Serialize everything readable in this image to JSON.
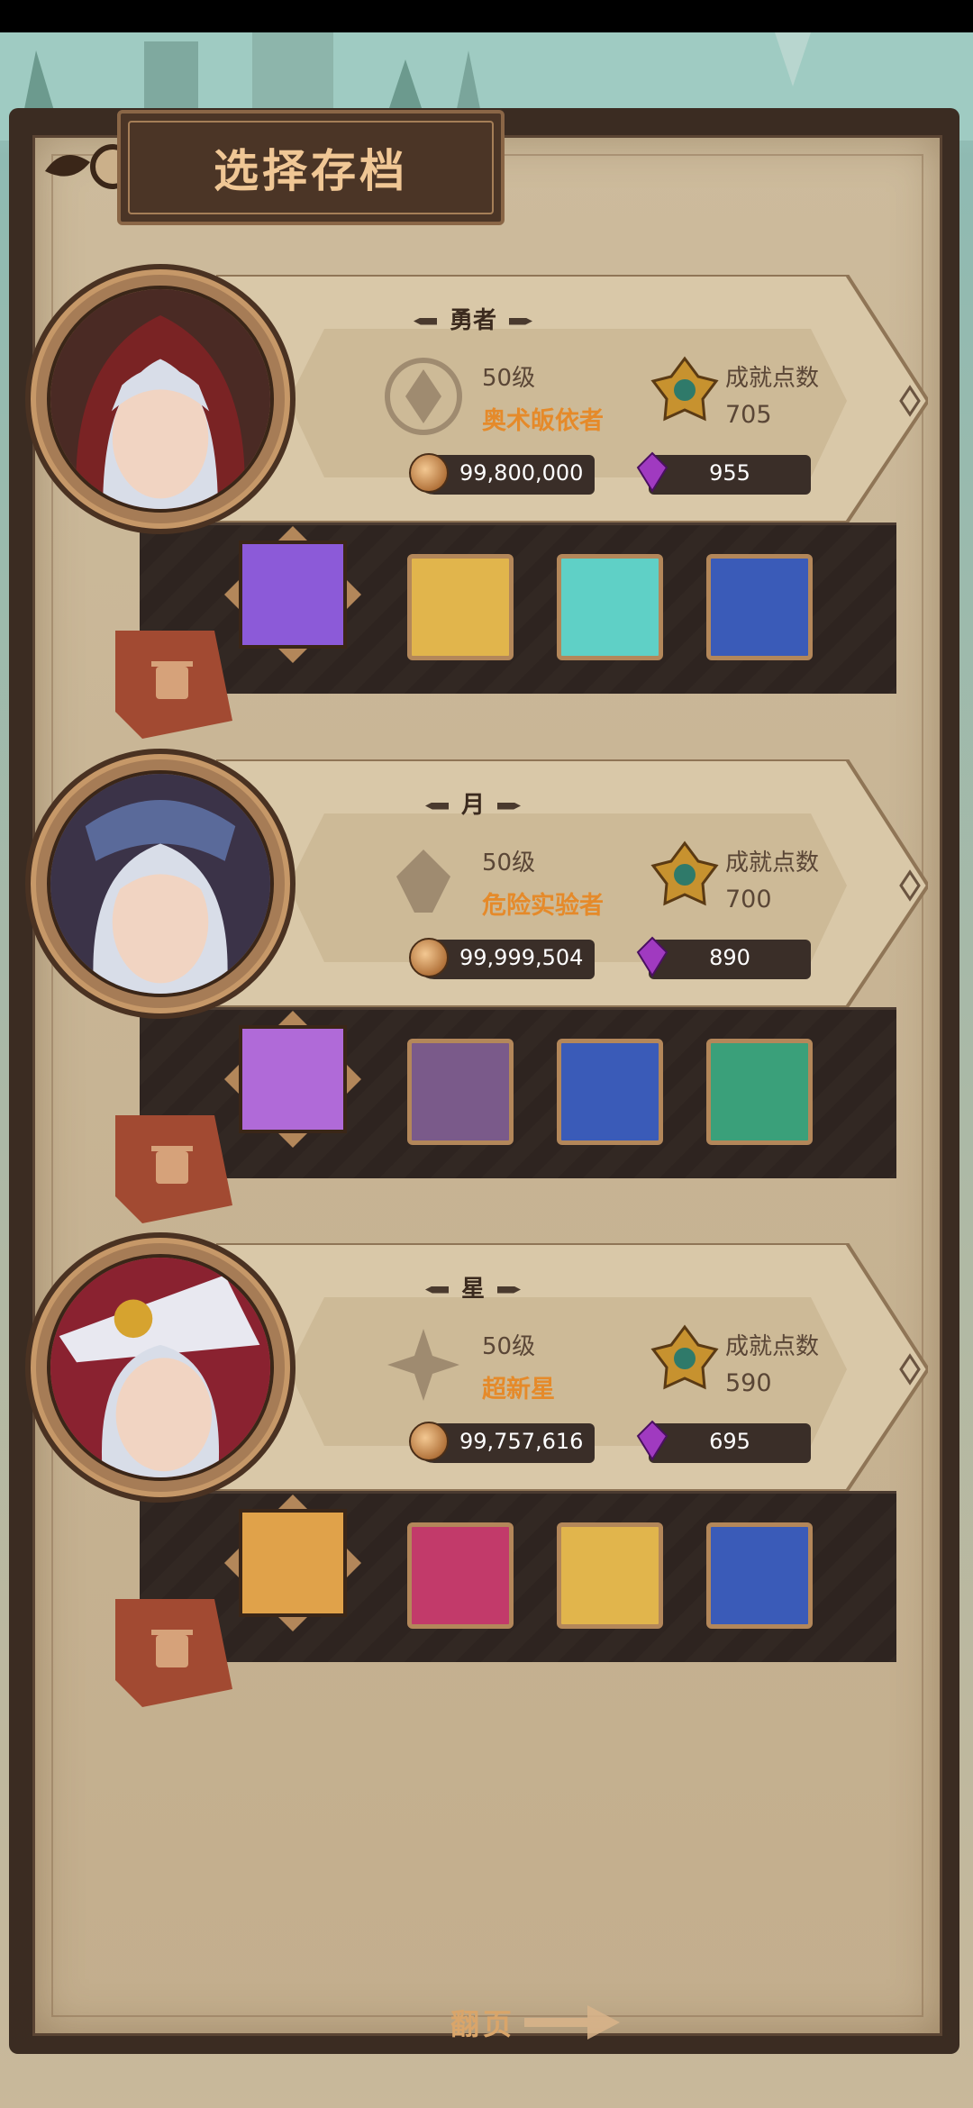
{
  "title": "选择存档",
  "footer": {
    "next_page": "翻页"
  },
  "slots": [
    {
      "name": "勇者",
      "level": "50级",
      "class_name": "奥术皈依者",
      "achievement_label": "成就点数",
      "achievement_value": "705",
      "coins": "99,800,000",
      "gems": "955",
      "portrait_palette": [
        "#7a2324",
        "#d8dde8",
        "#4a3a6a"
      ],
      "items": [
        "#8c5ad8",
        "#e1b54c",
        "#5fd0c6",
        "#3a5bb8"
      ]
    },
    {
      "name": "月",
      "level": "50级",
      "class_name": "危险实验者",
      "achievement_label": "成就点数",
      "achievement_value": "700",
      "coins": "99,999,504",
      "gems": "890",
      "portrait_palette": [
        "#5a6a9a",
        "#d8dde8",
        "#3b3348"
      ],
      "items": [
        "#b06ad8",
        "#7a5a8a",
        "#3a5bb8",
        "#3aa07a"
      ]
    },
    {
      "name": "星",
      "level": "50级",
      "class_name": "超新星",
      "achievement_label": "成就点数",
      "achievement_value": "590",
      "coins": "99,757,616",
      "gems": "695",
      "portrait_palette": [
        "#e8e8f0",
        "#d8dde8",
        "#8a2230"
      ],
      "items": [
        "#e0a24a",
        "#c23a6a",
        "#e1b54c",
        "#3a5bb8"
      ]
    }
  ],
  "colors": {
    "accent": "#e58a2a",
    "title": "#f0c795",
    "paper": "#c8b595",
    "tray": "#2e2420"
  }
}
